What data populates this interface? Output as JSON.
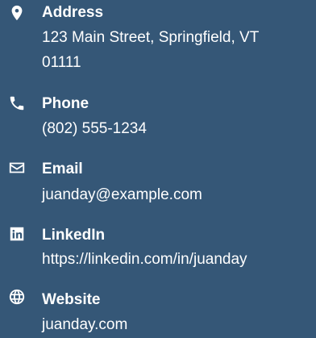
{
  "contacts": {
    "address": {
      "label": "Address",
      "line1": "123 Main Street, Springfield, VT",
      "line2": "01111",
      "icon": "map-pin-icon"
    },
    "phone": {
      "label": "Phone",
      "value": "(802) 555-1234",
      "icon": "phone-icon"
    },
    "email": {
      "label": "Email",
      "value": "juanday@example.com",
      "icon": "envelope-icon"
    },
    "linkedin": {
      "label": "LinkedIn",
      "value": "https://linkedin.com/in/juanday",
      "icon": "linkedin-icon"
    },
    "website": {
      "label": "Website",
      "value": "juanday.com",
      "icon": "globe-icon"
    }
  },
  "colors": {
    "background": "#355777",
    "text": "#ffffff"
  }
}
